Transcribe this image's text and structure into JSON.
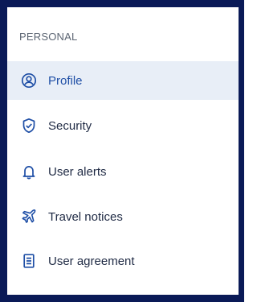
{
  "section": {
    "title": "PERSONAL"
  },
  "colors": {
    "frame": "#0a1a57",
    "active_bg": "#e8eef7",
    "active_text": "#1f4fa6",
    "icon": "#1f4fa6"
  },
  "items": [
    {
      "label": "Profile",
      "icon": "user-circle-icon",
      "active": true
    },
    {
      "label": "Security",
      "icon": "shield-check-icon",
      "active": false
    },
    {
      "label": "User alerts",
      "icon": "bell-icon",
      "active": false
    },
    {
      "label": "Travel notices",
      "icon": "airplane-icon",
      "active": false
    },
    {
      "label": "User agreement",
      "icon": "document-icon",
      "active": false
    }
  ]
}
